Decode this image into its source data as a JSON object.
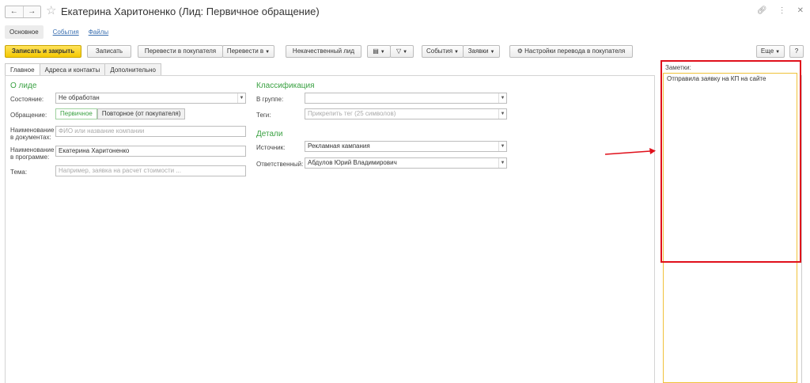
{
  "window": {
    "title": "Екатерина Харитоненко (Лид: Первичное обращение)"
  },
  "icons": {
    "back": "arrow-left-icon",
    "forward": "arrow-right-icon",
    "favorite": "star-icon",
    "link": "link-icon",
    "more": "more-vertical-icon",
    "close": "close-icon"
  },
  "sections": [
    {
      "label": "Основное",
      "active": true
    },
    {
      "label": "События",
      "active": false
    },
    {
      "label": "Файлы",
      "active": false
    }
  ],
  "toolbar": {
    "save_close": "Записать и закрыть",
    "save": "Записать",
    "to_customer": "Перевести в покупателя",
    "to_more": "Перевести в",
    "bad_lead": "Некачественный лид",
    "events": "События",
    "requests": "Заявки",
    "settings": "Настройки перевода в покупателя",
    "more": "Еще",
    "help": "?"
  },
  "form_tabs": [
    {
      "label": "Главное",
      "active": true
    },
    {
      "label": "Адреса и контакты",
      "active": false
    },
    {
      "label": "Дополнительно",
      "active": false
    }
  ],
  "about": {
    "heading": "О лиде",
    "state_label": "Состояние:",
    "state_value": "Не обработан",
    "appeal_label": "Обращение:",
    "appeal_options": [
      "Первичное",
      "Повторное (от покупателя)"
    ],
    "docname_label_1": "Наименование",
    "docname_label_2": "в документах:",
    "docname_placeholder": "ФИО или название компании",
    "progname_label_1": "Наименование",
    "progname_label_2": "в программе:",
    "progname_value": "Екатерина Харитоненко",
    "topic_label": "Тема:",
    "topic_placeholder": "Например, заявка на расчет стоимости ..."
  },
  "classification": {
    "heading": "Классификация",
    "group_label": "В группе:",
    "group_value": "",
    "tags_label": "Теги:",
    "tags_placeholder": "Прикрепить тег (25 символов)"
  },
  "details": {
    "heading": "Детали",
    "source_label": "Источник:",
    "source_value": "Рекламная кампания",
    "responsible_label": "Ответственный:",
    "responsible_value": "Абдулов Юрий Владимирович"
  },
  "notes": {
    "label": "Заметки:",
    "text": "Отправила заявку на КП на сайте"
  },
  "annotation": {
    "color": "#e0101b"
  }
}
